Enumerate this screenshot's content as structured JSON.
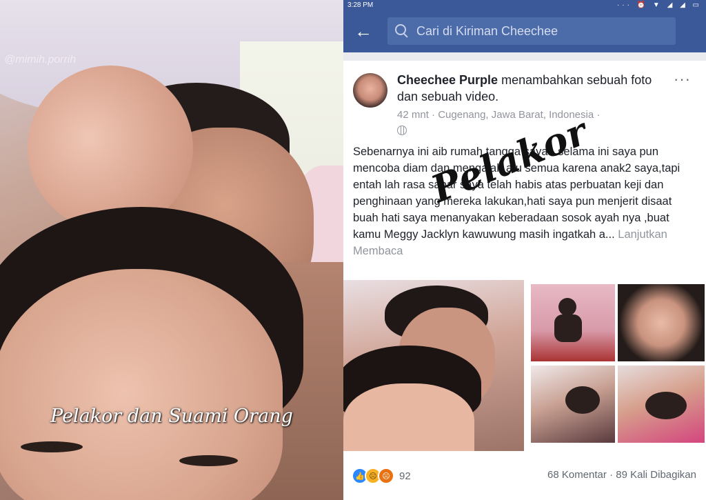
{
  "left": {
    "watermark": "@mimih.porrih",
    "caption": "Pelakor dan Suami Orang"
  },
  "status_bar": {
    "time": "3:28 PM",
    "icons": "··· ⏰ ▼ ◢ ◢ ▭"
  },
  "app_bar": {
    "back_icon": "←",
    "search_placeholder": "Cari di Kiriman Cheechee"
  },
  "post": {
    "author": "Cheechee Purple",
    "action": "menambahkan sebuah foto dan sebuah video.",
    "more_icon": "···",
    "time": "42 mnt",
    "location": "Cugenang, Jawa Barat, Indonesia",
    "text": "Sebenarnya ini aib rumah tangga saya - selama ini saya pun mencoba diam dan mengalah atu semua karena anak2 saya,tapi entah lah rasa sabar saya telah habis atas perbuatan keji dan penghinaan yang mereka lakukan,hati saya pun menjerit disaat buah hati saya menanyakan keberadaan sosok ayah nya ,buat kamu Meggy Jacklyn kawuwung masih ingatkah a...",
    "see_more": "Lanjutkan Membaca",
    "stamp": "Pelakor"
  },
  "engagement": {
    "reaction_count": "92",
    "comments": "68 Komentar",
    "shares": "89 Kali Dibagikan"
  }
}
